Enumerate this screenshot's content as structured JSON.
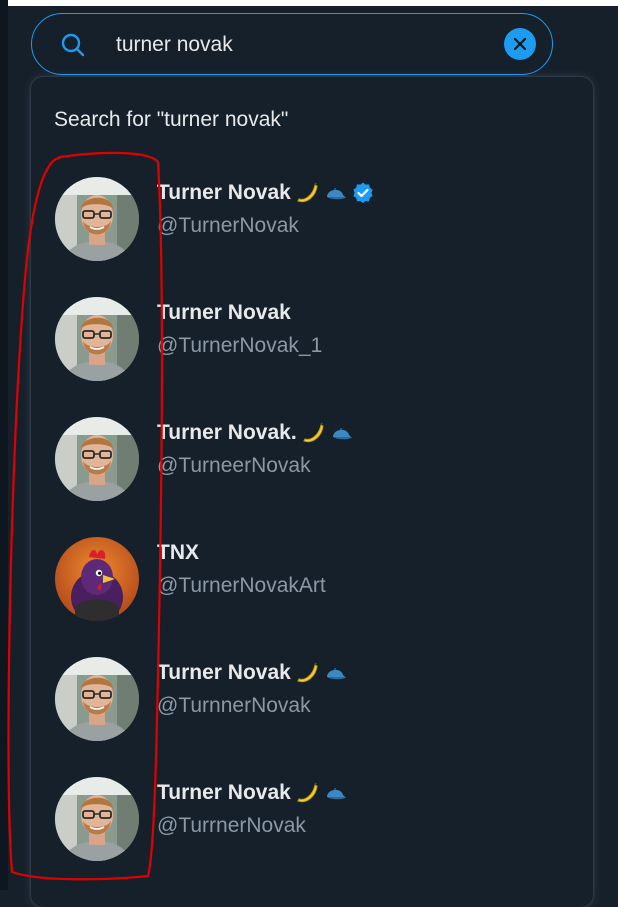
{
  "search": {
    "value": "turner novak",
    "placeholder": "Search"
  },
  "dropdown": {
    "search_for_label": "Search for \"turner novak\""
  },
  "results": [
    {
      "name": "Turner Novak",
      "handle": "@TurnerNovak",
      "banana": true,
      "cap": true,
      "verified": true,
      "avatar": "person-photo"
    },
    {
      "name": "Turner Novak",
      "handle": "@TurnerNovak_1",
      "banana": false,
      "cap": false,
      "verified": false,
      "avatar": "person-photo"
    },
    {
      "name": "Turner Novak.",
      "handle": "@TurneerNovak",
      "banana": true,
      "cap": true,
      "verified": false,
      "avatar": "person-photo"
    },
    {
      "name": "TNX",
      "handle": "@TurnerNovakArt",
      "banana": false,
      "cap": false,
      "verified": false,
      "avatar": "purple-chicken-art"
    },
    {
      "name": "Turner Novak",
      "handle": "@TurnnerNovak",
      "banana": true,
      "cap": true,
      "verified": false,
      "avatar": "person-photo"
    },
    {
      "name": "Turner Novak",
      "handle": "@TurrnerNovak",
      "banana": true,
      "cap": true,
      "verified": false,
      "avatar": "person-photo"
    }
  ],
  "colors": {
    "background": "#15202b",
    "accent": "#1d9bf0",
    "text_primary": "#e7e9ea",
    "text_secondary": "#8b98a5",
    "annotation_red": "#e00000"
  },
  "icons": {
    "search": "search-icon",
    "clear": "close-icon",
    "verified": "verified-badge-icon",
    "banana": "banana-emoji-icon",
    "cap": "blue-cap-emoji-icon"
  }
}
